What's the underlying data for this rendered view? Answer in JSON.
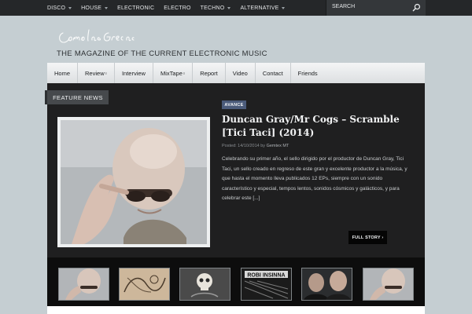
{
  "top_nav": {
    "items": [
      {
        "label": "DISCO",
        "has_dropdown": true
      },
      {
        "label": "HOUSE",
        "has_dropdown": true
      },
      {
        "label": "ELECTRONIC",
        "has_dropdown": false
      },
      {
        "label": "ELECTRO",
        "has_dropdown": false
      },
      {
        "label": "TECHNO",
        "has_dropdown": true
      },
      {
        "label": "ALTERNATIVE",
        "has_dropdown": true
      }
    ]
  },
  "search": {
    "placeholder": "SEARCH",
    "icon": "search-icon"
  },
  "site": {
    "logo_text": "Como las Grecas",
    "tagline": "THE MAGAZINE OF THE CURRENT ELECTRONIC MUSIC"
  },
  "main_nav": {
    "items": [
      {
        "label": "Home",
        "sup": ""
      },
      {
        "label": "Review",
        "sup": "≡"
      },
      {
        "label": "Interview",
        "sup": ""
      },
      {
        "label": "MixTape",
        "sup": "≡"
      },
      {
        "label": "Report",
        "sup": ""
      },
      {
        "label": "Video",
        "sup": ""
      },
      {
        "label": "Contact",
        "sup": ""
      },
      {
        "label": "Friends",
        "sup": ""
      }
    ]
  },
  "feature": {
    "section_label": "FEATURE NEWS",
    "category": "AVANCE",
    "title": "Duncan Gray/Mr Cogs – Scramble [Tici Taci] (2014)",
    "posted_prefix": "Posted: 14/10/2014  by ",
    "author": "Gemtex MT",
    "excerpt": "Celebrando su primer año, el sello dirigido por el productor de Duncan Gray, Tici Taci, un sello creado en regreso de este gran y excelente productor a la música, y que hasta el momento lleva publicados 12 EPs, siempre con un sonido característico y especial, tempos lentos, sonidos cósmicos y galácticos, y para celebrar este [...]",
    "button": "FULL STORY ›"
  },
  "thumbnails": [
    {
      "alt": "bald man with sunglasses"
    },
    {
      "alt": "sketch artwork"
    },
    {
      "alt": "skull artwork"
    },
    {
      "alt": "ROBI INSINNA"
    },
    {
      "alt": "two men portrait"
    },
    {
      "alt": "bald man with sunglasses"
    }
  ],
  "thumb_text": {
    "robi": "ROBI INSINNA"
  },
  "colors": {
    "page_bg": "#c5ced2",
    "top_bar": "#252729",
    "feature_bg": "#1f1f20",
    "badge": "#4b5b7a",
    "thumb_strip": "#0d0d0d"
  }
}
